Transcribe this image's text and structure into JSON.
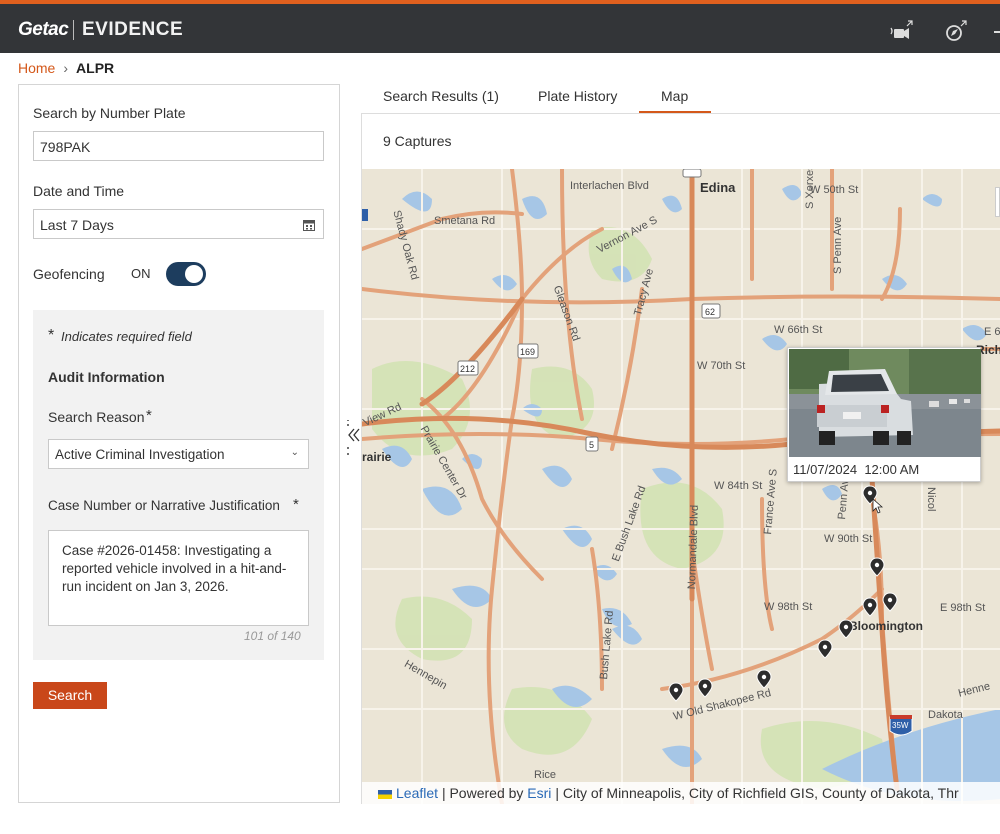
{
  "app": {
    "logo": "Getac",
    "product": "EVIDENCE"
  },
  "breadcrumb": {
    "home": "Home",
    "current": "ALPR"
  },
  "search_form": {
    "plate_label": "Search by Number Plate",
    "plate_value": "798PAK",
    "date_label": "Date and Time",
    "date_value": "Last 7 Days",
    "geofencing_label": "Geofencing",
    "geofencing_state": "ON",
    "required_note": "Indicates required field",
    "audit_heading": "Audit Information",
    "reason_label": "Search Reason",
    "reason_value": "Active Criminal Investigation",
    "justification_label": "Case Number or Narrative Justification",
    "justification_value": "Case #2026-01458: Investigating a reported vehicle involved in a hit-and-run incident on Jan 3, 2026.",
    "char_count": "101 of 140",
    "search_button": "Search"
  },
  "tabs": [
    {
      "label": "Search Results (1)"
    },
    {
      "label": "Plate History"
    },
    {
      "label": "Map"
    }
  ],
  "map": {
    "captures_count": "9 Captures",
    "popup_timestamp": "11/07/2024  12:00 AM",
    "labels": {
      "edina": "Edina",
      "interlachen": "Interlachen Blvd",
      "w50th": "W 50th St",
      "smetana": "Smetana Rd",
      "vernon": "Vernon Ave S",
      "shady_oak": "Shady Oak Rd",
      "xerxes": "S Xerxes Ave",
      "penn": "S Penn Ave",
      "gleason": "Gleason Rd",
      "tracy": "Tracy Ave",
      "w66th": "W 66th St",
      "e66": "E 6",
      "rich": "Rich",
      "w70th": "W 70th St",
      "view_rd": "View Rd",
      "prairie": "rairie",
      "prairie_center": "Prairie Center Dr",
      "w84th": "W 84th St",
      "bush_lake": "E Bush Lake Rd",
      "normandale": "Normandale Blvd",
      "france": "France Ave S",
      "penn_ave": "Penn Ave",
      "nicollet": "Nicol",
      "w90th": "W 90th St",
      "w98th": "W 98th St",
      "e98th": "E 98th St",
      "bloomington": "Bloomington",
      "bush_lake_rd": "Bush Lake Rd",
      "old_shakopee": "W Old Shakopee Rd",
      "hennepin": "Hennepin",
      "hennepin2": "Henne",
      "dakota": "Dakota",
      "rice": "Rice",
      "hwy62": "62",
      "hwy169": "169",
      "hwy212": "212",
      "hwy5": "5",
      "i35w": "35W"
    },
    "attribution": {
      "leaflet": "Leaflet",
      "powered_by": "Powered by",
      "esri": "Esri",
      "sources": "City of Minneapolis, City of Richfield GIS, County of Dakota, Thr"
    }
  },
  "colors": {
    "accent": "#d4581a",
    "topbar": "#333538",
    "toggle_on": "#1d3d5e",
    "search_button": "#c9471a",
    "map_road": "#e09a6e",
    "map_water": "#a8c8e8",
    "map_park": "#cfe0b0"
  }
}
